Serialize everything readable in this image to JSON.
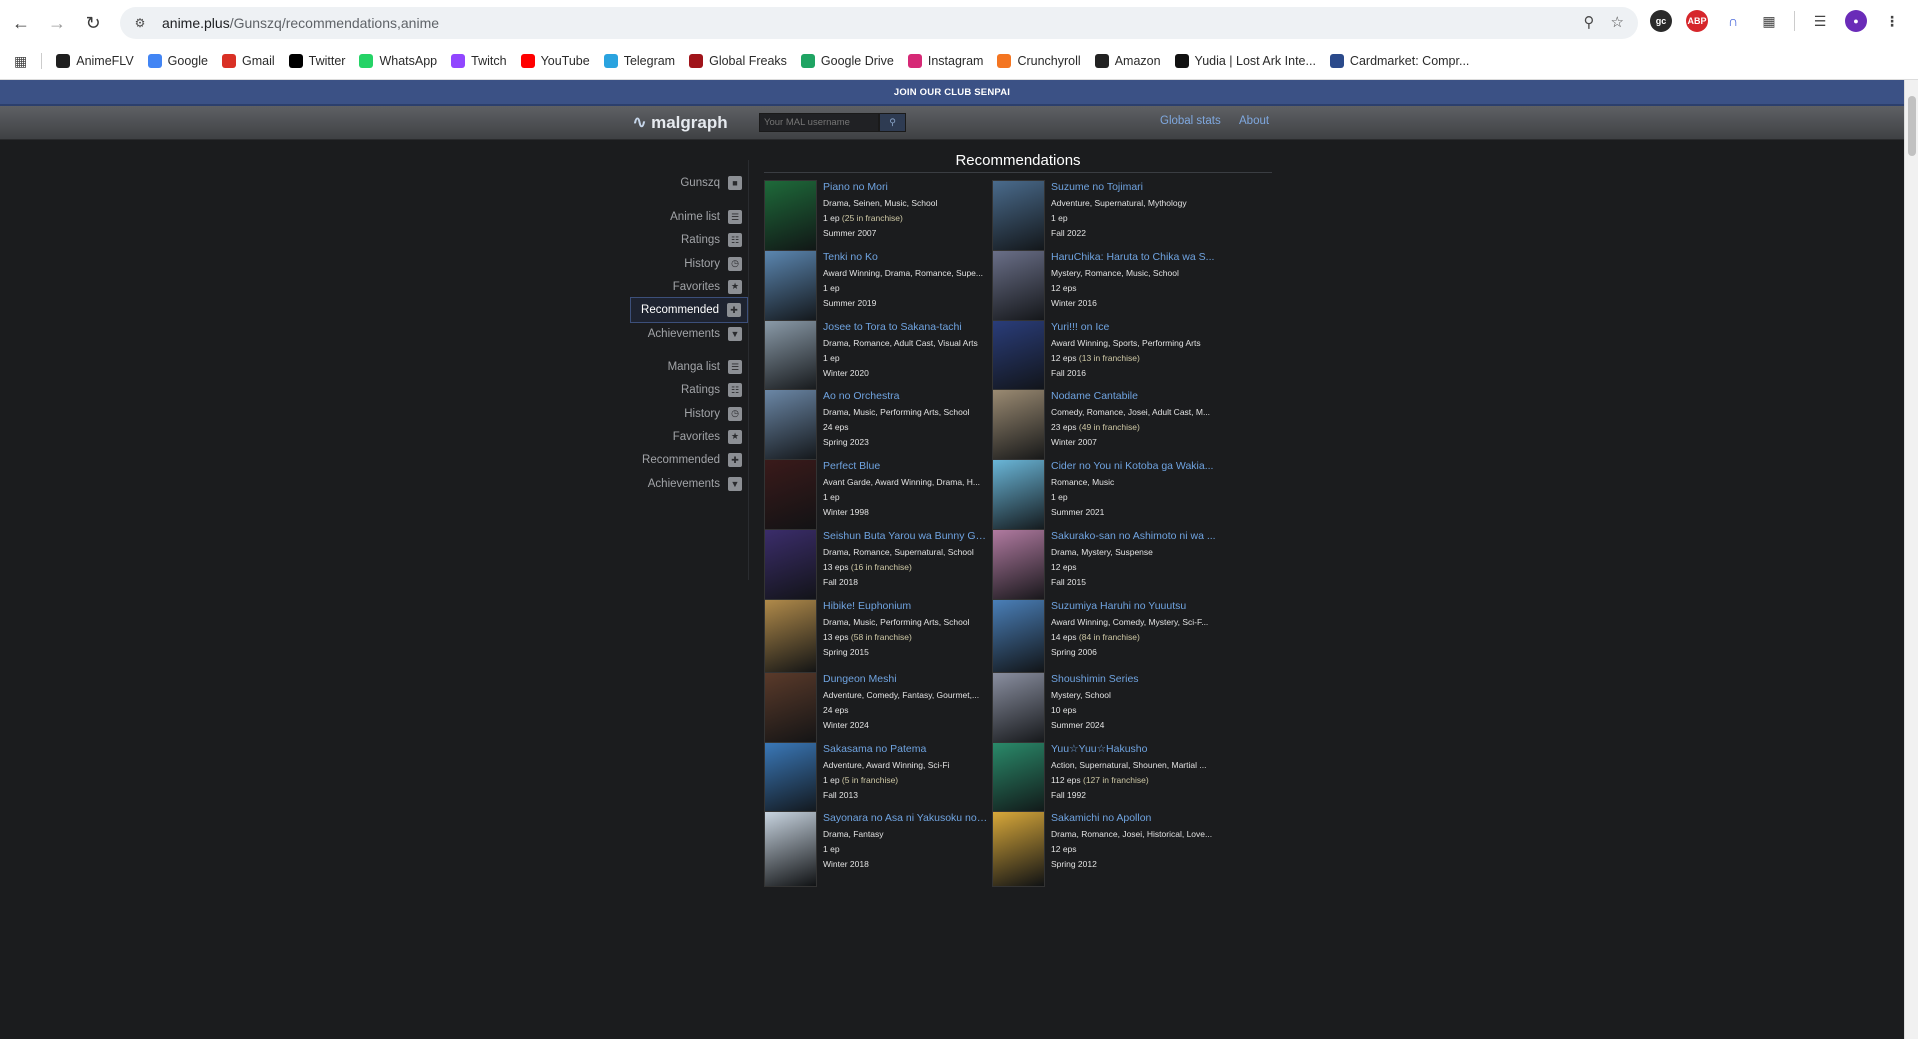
{
  "browser": {
    "url_host": "anime.plus",
    "url_path": "/Gunszq/recommendations,anime",
    "bookmarks": [
      {
        "label": "AnimeFLV",
        "icon": "animeflv-icon",
        "color": "#1f1f1f"
      },
      {
        "label": "Google",
        "icon": "google-icon",
        "color": "#4285f4"
      },
      {
        "label": "Gmail",
        "icon": "gmail-icon",
        "color": "#d93025"
      },
      {
        "label": "Twitter",
        "icon": "x-icon",
        "color": "#000000"
      },
      {
        "label": "WhatsApp",
        "icon": "whatsapp-icon",
        "color": "#25d366"
      },
      {
        "label": "Twitch",
        "icon": "twitch-icon",
        "color": "#9146ff"
      },
      {
        "label": "YouTube",
        "icon": "youtube-icon",
        "color": "#ff0000"
      },
      {
        "label": "Telegram",
        "icon": "telegram-icon",
        "color": "#2aa3df"
      },
      {
        "label": "Global Freaks",
        "icon": "globalfreaks-icon",
        "color": "#a0141a"
      },
      {
        "label": "Google Drive",
        "icon": "drive-icon",
        "color": "#1fa463"
      },
      {
        "label": "Instagram",
        "icon": "instagram-icon",
        "color": "#d62976"
      },
      {
        "label": "Crunchyroll",
        "icon": "crunchyroll-icon",
        "color": "#f47521"
      },
      {
        "label": "Amazon",
        "icon": "amazon-icon",
        "color": "#222222"
      },
      {
        "label": "Yudia | Lost Ark Inte...",
        "icon": "yudia-icon",
        "color": "#111111"
      },
      {
        "label": "Cardmarket: Compr...",
        "icon": "cardmarket-icon",
        "color": "#2b4a8b"
      }
    ]
  },
  "site": {
    "club_banner": "JOIN OUR CLUB SENPAI",
    "logo": "malgraph",
    "search_placeholder": "Your MAL username",
    "nav": {
      "global_stats": "Global stats",
      "about": "About"
    }
  },
  "sidebar": {
    "user": "Gunszq",
    "anime": [
      "Anime list",
      "Ratings",
      "History",
      "Favorites",
      "Recommended",
      "Achievements"
    ],
    "manga": [
      "Manga list",
      "Ratings",
      "History",
      "Favorites",
      "Recommended",
      "Achievements"
    ]
  },
  "recommendations": {
    "title": "Recommendations",
    "items": [
      {
        "title": "Piano no Mori",
        "genres": "Drama, Seinen, Music, School",
        "eps": "1 ep",
        "franchise": "(25 in franchise)",
        "season": "Summer 2007",
        "color": "#1e6a3a"
      },
      {
        "title": "Suzume no Tojimari",
        "genres": "Adventure, Supernatural, Mythology",
        "eps": "1 ep",
        "franchise": "",
        "season": "Fall 2022",
        "color": "#4a6b8c"
      },
      {
        "title": "Tenki no Ko",
        "genres": "Award Winning, Drama, Romance, Supe...",
        "eps": "1 ep",
        "franchise": "",
        "season": "Summer 2019",
        "color": "#5b86b0"
      },
      {
        "title": "HaruChika: Haruta to Chika wa S...",
        "genres": "Mystery, Romance, Music, School",
        "eps": "12 eps",
        "franchise": "",
        "season": "Winter 2016",
        "color": "#6a6f88"
      },
      {
        "title": "Josee to Tora to Sakana-tachi",
        "genres": "Drama, Romance, Adult Cast, Visual Arts",
        "eps": "1 ep",
        "franchise": "",
        "season": "Winter 2020",
        "color": "#8a9aa8"
      },
      {
        "title": "Yuri!!! on Ice",
        "genres": "Award Winning, Sports, Performing Arts",
        "eps": "12 eps",
        "franchise": "(13 in franchise)",
        "season": "Fall 2016",
        "color": "#2a3d7a"
      },
      {
        "title": "Ao no Orchestra",
        "genres": "Drama, Music, Performing Arts, School",
        "eps": "24 eps",
        "franchise": "",
        "season": "Spring 2023",
        "color": "#6b87a6"
      },
      {
        "title": "Nodame Cantabile",
        "genres": "Comedy, Romance, Josei, Adult Cast, M...",
        "eps": "23 eps",
        "franchise": "(49 in franchise)",
        "season": "Winter 2007",
        "color": "#9a8a72"
      },
      {
        "title": "Perfect Blue",
        "genres": "Avant Garde, Award Winning, Drama, H...",
        "eps": "1 ep",
        "franchise": "",
        "season": "Winter 1998",
        "color": "#3a1a1a"
      },
      {
        "title": "Cider no You ni Kotoba ga Wakia...",
        "genres": "Romance, Music",
        "eps": "1 ep",
        "franchise": "",
        "season": "Summer 2021",
        "color": "#6ab6d8"
      },
      {
        "title": "Seishun Buta Yarou wa Bunny Gir...",
        "genres": "Drama, Romance, Supernatural, School",
        "eps": "13 eps",
        "franchise": "(16 in franchise)",
        "season": "Fall 2018",
        "color": "#3b2d6b"
      },
      {
        "title": "Sakurako-san no Ashimoto ni wa ...",
        "genres": "Drama, Mystery, Suspense",
        "eps": "12 eps",
        "franchise": "",
        "season": "Fall 2015",
        "color": "#b07aa0"
      },
      {
        "title": "Hibike! Euphonium",
        "genres": "Drama, Music, Performing Arts, School",
        "eps": "13 eps",
        "franchise": "(58 in franchise)",
        "season": "Spring 2015",
        "color": "#b08a4a"
      },
      {
        "title": "Suzumiya Haruhi no Yuuutsu",
        "genres": "Award Winning, Comedy, Mystery, Sci-F...",
        "eps": "14 eps",
        "franchise": "(84 in franchise)",
        "season": "Spring 2006",
        "color": "#4a7fb8"
      },
      {
        "title": "Dungeon Meshi",
        "genres": "Adventure, Comedy, Fantasy, Gourmet,...",
        "eps": "24 eps",
        "franchise": "",
        "season": "Winter 2024",
        "color": "#5a3a2a"
      },
      {
        "title": "Shoushimin Series",
        "genres": "Mystery, School",
        "eps": "10 eps",
        "franchise": "",
        "season": "Summer 2024",
        "color": "#8a8fa0"
      },
      {
        "title": "Sakasama no Patema",
        "genres": "Adventure, Award Winning, Sci-Fi",
        "eps": "1 ep",
        "franchise": "(5 in franchise)",
        "season": "Fall 2013",
        "color": "#3a78b8"
      },
      {
        "title": "Yuu☆Yuu☆Hakusho",
        "genres": "Action, Supernatural, Shounen, Martial ...",
        "eps": "112 eps",
        "franchise": "(127 in franchise)",
        "season": "Fall 1992",
        "color": "#2a8a6a"
      },
      {
        "title": "Sayonara no Asa ni Yakusoku no ...",
        "genres": "Drama, Fantasy",
        "eps": "1 ep",
        "franchise": "",
        "season": "Winter 2018",
        "color": "#c8d4e0"
      },
      {
        "title": "Sakamichi no Apollon",
        "genres": "Drama, Romance, Josei, Historical, Love...",
        "eps": "12 eps",
        "franchise": "",
        "season": "Spring 2012",
        "color": "#d8a83a"
      }
    ]
  }
}
